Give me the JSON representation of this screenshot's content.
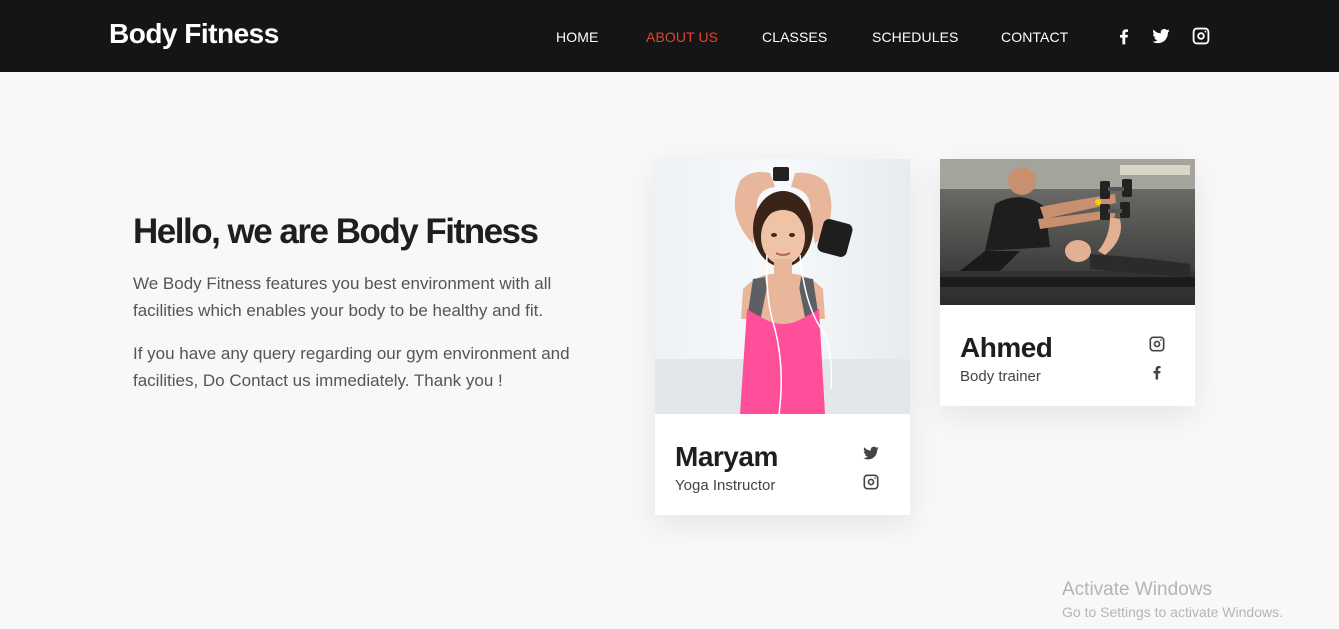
{
  "header": {
    "brand": "Body Fitness",
    "nav": [
      {
        "label": "HOME",
        "active": false
      },
      {
        "label": "ABOUT US",
        "active": true
      },
      {
        "label": "CLASSES",
        "active": false
      },
      {
        "label": "SCHEDULES",
        "active": false
      },
      {
        "label": "CONTACT",
        "active": false
      }
    ],
    "social_icons": [
      "facebook-icon",
      "twitter-icon",
      "instagram-icon"
    ]
  },
  "intro": {
    "title": "Hello, we are Body Fitness",
    "paragraphs": [
      "We Body Fitness features you best environment with all facilities which enables your body to be healthy and fit.",
      "If you have any query regarding our gym environment and facilities, Do Contact us immediately. Thank you !"
    ]
  },
  "trainers": [
    {
      "name": "Maryam",
      "role": "Yoga Instructor",
      "icons": [
        "twitter-icon",
        "instagram-icon"
      ]
    },
    {
      "name": "Ahmed",
      "role": "Body trainer",
      "icons": [
        "instagram-icon",
        "facebook-icon"
      ]
    }
  ],
  "watermark": {
    "title": "Activate Windows",
    "subtitle": "Go to Settings to activate Windows."
  },
  "colors": {
    "header_bg": "#141516",
    "accent": "#e8412c",
    "page_bg": "#f8f8f8",
    "pink_top": "#ff4f9a"
  }
}
